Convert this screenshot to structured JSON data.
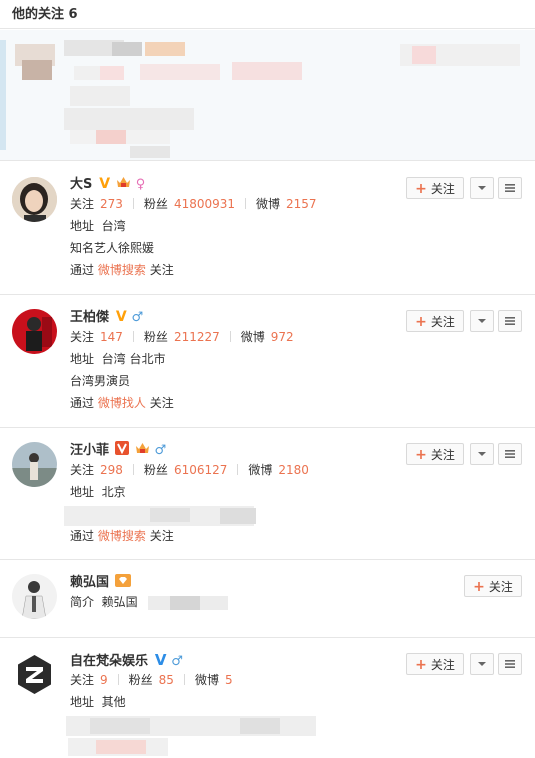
{
  "header": {
    "title": "他的关注 6"
  },
  "labels": {
    "follow_btn": "关注",
    "following": "关注",
    "fans": "粉丝",
    "weibo": "微博",
    "address": "地址",
    "via": "通过",
    "follow_suffix": "关注",
    "intro": "简介"
  },
  "users": [
    {
      "name": "大S",
      "following": "273",
      "fans": "41800931",
      "weibo": "2157",
      "address": "台湾",
      "bio": "知名艺人徐熙媛",
      "source": "微博搜索"
    },
    {
      "name": "王柏傑",
      "following": "147",
      "fans": "211227",
      "weibo": "972",
      "address": "台湾 台北市",
      "bio": "台湾男演员",
      "source": "微博找人"
    },
    {
      "name": "汪小菲",
      "following": "298",
      "fans": "6106127",
      "weibo": "2180",
      "address": "北京",
      "source": "微博搜索"
    },
    {
      "name": "赖弘国",
      "intro_value": "赖弘国"
    },
    {
      "name": "自在梵朵娱乐",
      "following": "9",
      "fans": "85",
      "weibo": "5",
      "address": "其他"
    }
  ],
  "colors": {
    "accent": "#eb7350",
    "verified_gold": "#ffa00a",
    "verified_blue": "#2d8de6"
  }
}
